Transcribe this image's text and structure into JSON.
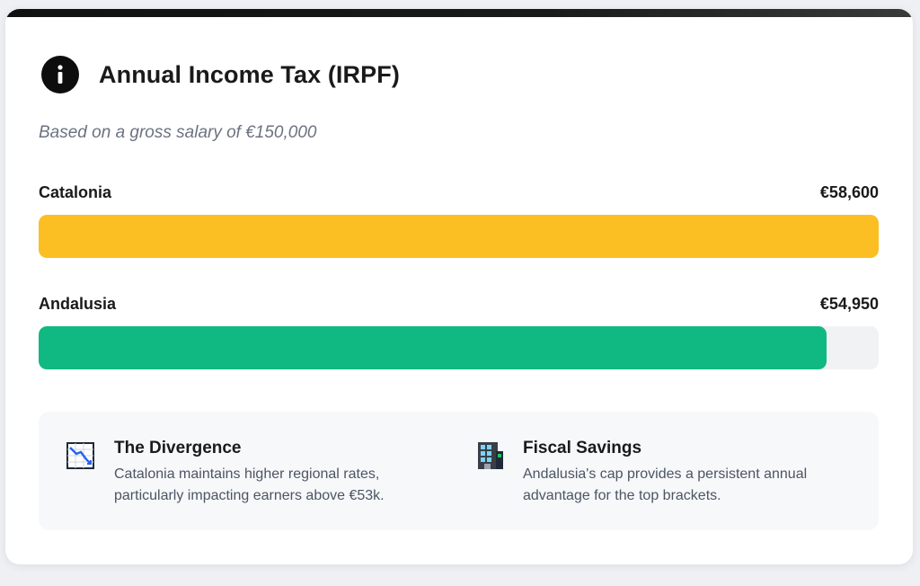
{
  "header": {
    "icon": "info-icon",
    "title": "Annual Income Tax (IRPF)"
  },
  "subtitle": "Based on a gross salary of €150,000",
  "regions": [
    {
      "name": "Catalonia",
      "amount": "€58,600",
      "fill_fraction": 1.0,
      "color": "#fbbf24"
    },
    {
      "name": "Andalusia",
      "amount": "€54,950",
      "fill_fraction": 0.9377,
      "color": "#10b981"
    }
  ],
  "notes": [
    {
      "icon": "chart-decreasing-icon",
      "title": "The Divergence",
      "lines": [
        "Catalonia maintains higher regional rates,",
        "particularly impacting earners above €53k."
      ]
    },
    {
      "icon": "office-building-icon",
      "title": "Fiscal Savings",
      "lines": [
        "Andalusia's cap provides a persistent annual",
        "advantage for the top brackets."
      ]
    }
  ],
  "colors": {
    "track": "#f1f2f4",
    "notes_bg": "#f7f8fa"
  }
}
